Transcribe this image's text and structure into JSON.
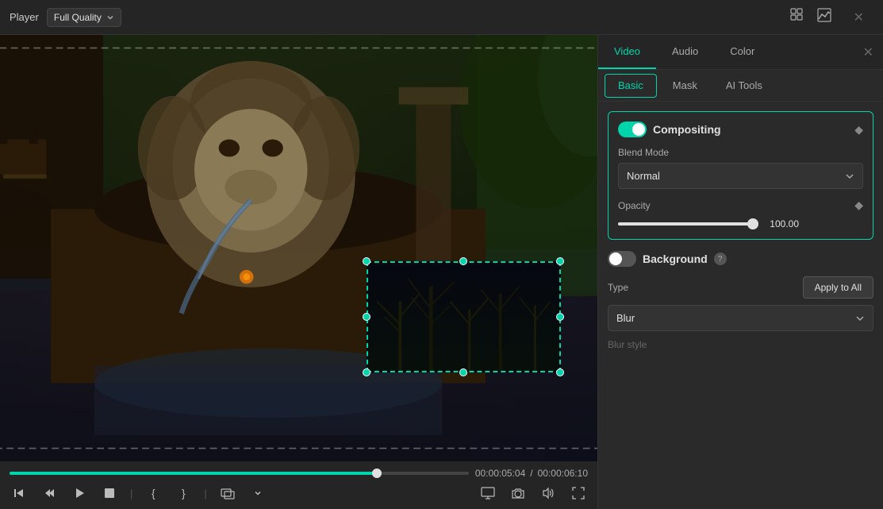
{
  "toolbar": {
    "player_label": "Player",
    "quality_label": "Full Quality",
    "layout_icon": "grid-icon",
    "chart_icon": "chart-icon",
    "close_icon": "close-icon"
  },
  "video": {
    "current_time": "00:00:05:04",
    "total_time": "00:00:06:10",
    "progress_percent": 80
  },
  "controls": {
    "skip_back_label": "⏮",
    "play_back_label": "⏪",
    "play_label": "▶",
    "stop_label": "⬛",
    "mark_in_label": "{",
    "mark_out_label": "}",
    "overlay_label": "⊞",
    "monitor_label": "🖥",
    "screenshot_label": "📷",
    "volume_label": "🔊",
    "fullscreen_label": "⤢"
  },
  "right_panel": {
    "tabs_top": [
      {
        "id": "video",
        "label": "Video",
        "active": true
      },
      {
        "id": "audio",
        "label": "Audio",
        "active": false
      },
      {
        "id": "color",
        "label": "Color",
        "active": false
      }
    ],
    "tabs_sub": [
      {
        "id": "basic",
        "label": "Basic",
        "active": true
      },
      {
        "id": "mask",
        "label": "Mask",
        "active": false
      },
      {
        "id": "ai-tools",
        "label": "AI Tools",
        "active": false
      }
    ],
    "compositing": {
      "title": "Compositing",
      "enabled": true,
      "blend_mode_label": "Blend Mode",
      "blend_mode_value": "Normal",
      "opacity_label": "Opacity",
      "opacity_value": "100.00"
    },
    "background": {
      "title": "Background",
      "enabled": false,
      "help_text": "?",
      "type_label": "Type",
      "apply_all_label": "Apply to All",
      "type_value": "Blur",
      "blur_style_label": "Blur style"
    }
  }
}
